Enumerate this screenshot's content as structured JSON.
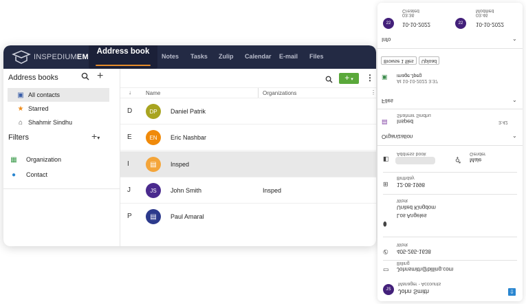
{
  "app": {
    "logo_light": "INSPEDIUM",
    "logo_bold": "EMAIL",
    "active_tab": "Address book",
    "nav": [
      "Notes",
      "Tasks",
      "Zulip",
      "Calendar",
      "E-mail",
      "Files"
    ]
  },
  "sidebar": {
    "title": "Address books",
    "items": [
      {
        "label": "All contacts",
        "icon": "contacts-icon"
      },
      {
        "label": "Starred",
        "icon": "star-icon"
      },
      {
        "label": "Shahmir Sindhu",
        "icon": "home-icon"
      }
    ],
    "filters_title": "Filters",
    "filters": [
      {
        "label": "Organization",
        "icon": "organization-icon"
      },
      {
        "label": "Contact",
        "icon": "person-icon"
      }
    ]
  },
  "list": {
    "col_name": "Name",
    "col_org": "Organizations",
    "rows": [
      {
        "letter": "D",
        "initials": "DP",
        "name": "Daniel Patrik",
        "org": "",
        "color": "#a8a420"
      },
      {
        "letter": "E",
        "initials": "EN",
        "name": "Eric Nashbar",
        "org": "",
        "color": "#f08a0a"
      },
      {
        "letter": "I",
        "initials": "▤",
        "name": "Insped",
        "org": "",
        "color": "#f4a53a"
      },
      {
        "letter": "J",
        "initials": "JS",
        "name": "John Smith",
        "org": "Insped",
        "color": "#4a2a8e"
      },
      {
        "letter": "P",
        "initials": "▤",
        "name": "Paul Amaral",
        "org": "",
        "color": "#2c3a8c"
      }
    ]
  },
  "panel": {
    "created_label": "Created",
    "created_date": "10-10-2022",
    "created_time": "03:36",
    "modified_label": "Modified",
    "modified_date": "10-10-2022",
    "modified_time": "03:46",
    "avatar_num": "22",
    "info_label": "Info",
    "browse_btn": "Browse 1 files",
    "upload_btn": "Upload",
    "file_name": "image.Jpeg",
    "file_date": "At 10-10-2022 3:37",
    "files_label": "Files",
    "org_name": "Insped",
    "org_person": "Shahmir Sindhu",
    "org_time": "3:42",
    "organization_label": "Organization",
    "address_book_label": "Address book",
    "gender_label": "Gender",
    "gender_value": "Male",
    "birthday_label": "Birthday",
    "birthday_value": "12-08-1998",
    "work_label": "Work",
    "country": "United Kingdom",
    "city": "Los Angeles",
    "work_phone_label": "Work",
    "phone": "405-265-1638",
    "billing_label": "Billing",
    "email": "Johnsmith@billing.com",
    "title": "Manager - Accounts",
    "contact_name": "John Smith",
    "contact_avatar": "JS"
  }
}
